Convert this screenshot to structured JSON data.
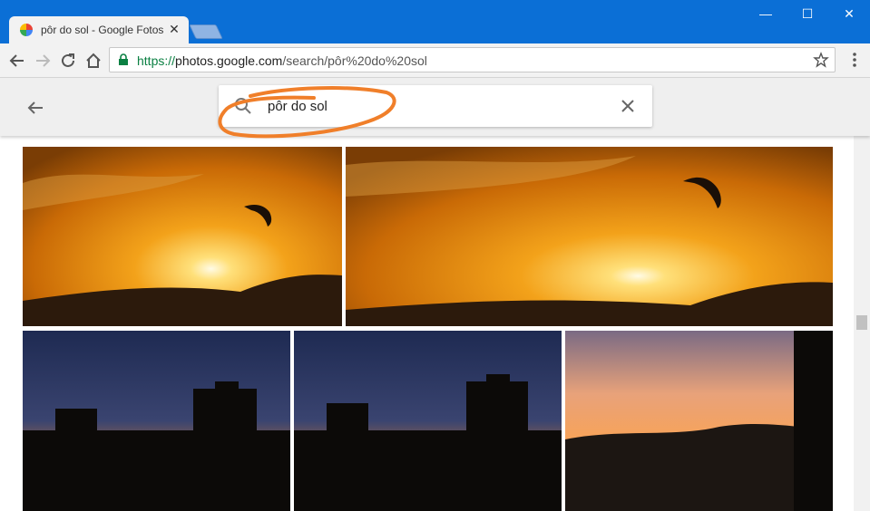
{
  "browser": {
    "tab_title": "pôr do sol - Google Fotos",
    "tab_close": "✕",
    "url_scheme": "https://",
    "url_host": "photos.google.com",
    "url_path": "/search/p%C3%B3r%20do%20sol",
    "url_path_display": "/search/pôr%20do%20sol",
    "window_controls": {
      "minimize": "—",
      "maximize": "☐",
      "close": "✕"
    },
    "accent_color": "#0b6fd6",
    "secure_color": "#0b8043"
  },
  "app": {
    "search": {
      "query": "pôr do sol",
      "icon": "search-icon",
      "clear_icon": "close-icon"
    },
    "back_icon": "arrow-back-icon",
    "annotation_color": "#f07f2a"
  },
  "photos": [
    {
      "name": "photo-sunset-bird-1",
      "subject": "sunset with bird"
    },
    {
      "name": "photo-sunset-bird-2",
      "subject": "sunset with bird"
    },
    {
      "name": "photo-city-dusk-1",
      "subject": "city skyline at dusk"
    },
    {
      "name": "photo-city-dusk-2",
      "subject": "city skyline at dusk"
    },
    {
      "name": "photo-hills-dusk",
      "subject": "hills at dusk"
    }
  ]
}
